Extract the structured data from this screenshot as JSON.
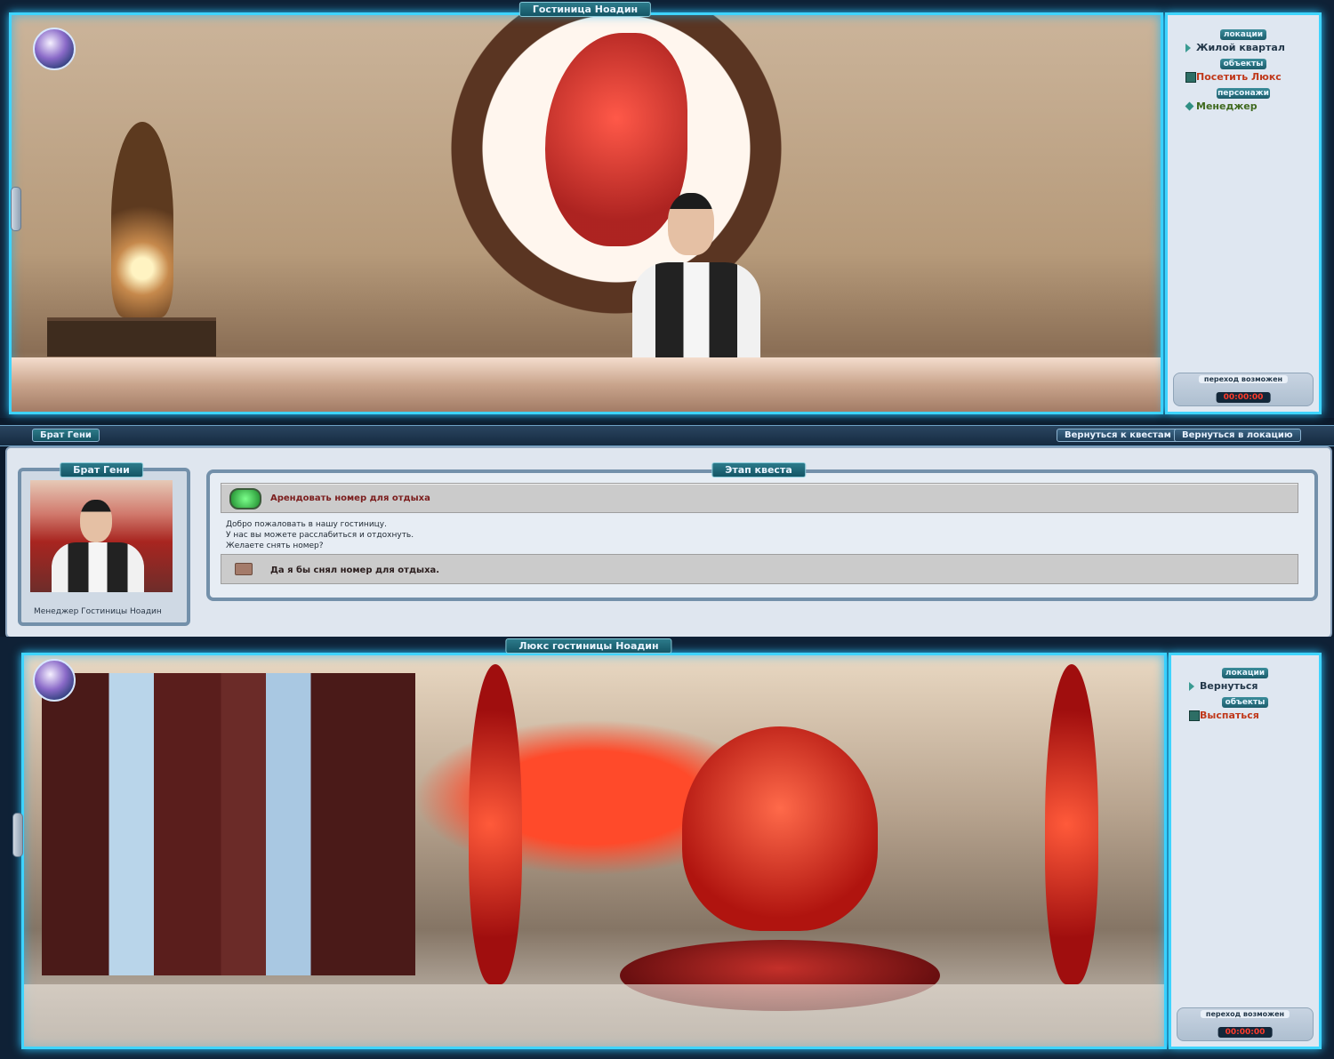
{
  "top_location": {
    "title": "Гостиница Ноадин",
    "sections": {
      "locations_label": "локации",
      "objects_label": "объекты",
      "characters_label": "персонажи"
    },
    "locations": [
      "Жилой квартал"
    ],
    "objects": [
      "Посетить Люкс"
    ],
    "characters": [
      "Менеджер"
    ],
    "transition_label": "переход возможен",
    "timer": "00:00:00"
  },
  "quest_bar": {
    "npc_tab": "Брат Гени",
    "back_to_quests": "Вернуться к квестам",
    "back_to_location": "Вернуться в локацию"
  },
  "quest": {
    "portrait_title": "Брат Гени",
    "portrait_caption": "Менеджер Гостиницы Ноадин",
    "stage_label": "Этап квеста",
    "task": "Арендовать номер для отдыха",
    "text_lines": [
      "Добро пожаловать в нашу гостиницу.",
      "У нас вы можете расслабиться и отдохнуть.",
      "Желаете снять номер?"
    ],
    "answer": "Да я бы снял номер для отдыха."
  },
  "bottom_location": {
    "title": "Люкс гостиницы Ноадин",
    "sections": {
      "locations_label": "локации",
      "objects_label": "объекты"
    },
    "locations": [
      "Вернуться"
    ],
    "objects": [
      "Выспаться"
    ],
    "transition_label": "переход возможен",
    "timer": "00:00:00"
  },
  "colors": {
    "accent_glow": "#3ed4ff",
    "location_text": "#23384a",
    "object_text": "#c0391b",
    "character_text": "#3f6a1f",
    "timer": "#ff3a2a"
  }
}
